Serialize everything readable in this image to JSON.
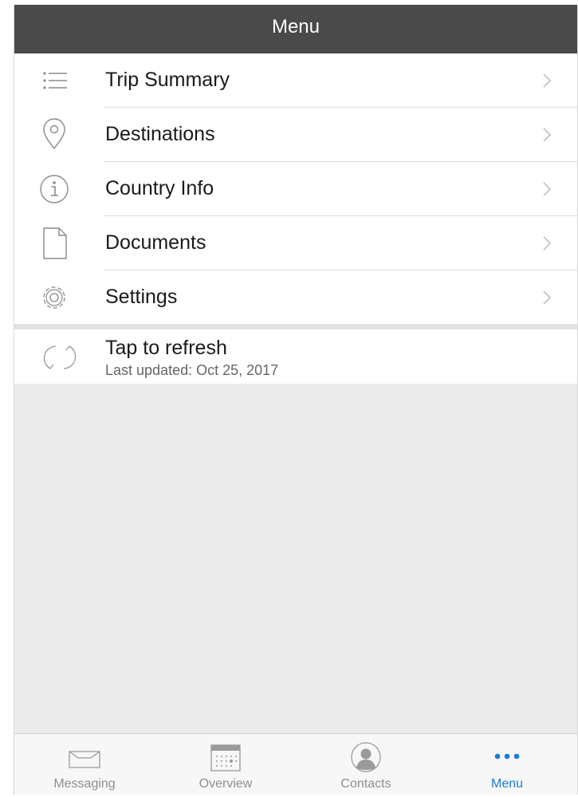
{
  "header": {
    "title": "Menu"
  },
  "menu": {
    "items": [
      {
        "label": "Trip Summary",
        "icon": "list-icon"
      },
      {
        "label": "Destinations",
        "icon": "location-pin-icon"
      },
      {
        "label": "Country Info",
        "icon": "info-icon"
      },
      {
        "label": "Documents",
        "icon": "document-icon"
      },
      {
        "label": "Settings",
        "icon": "gear-icon"
      }
    ]
  },
  "refresh": {
    "label": "Tap to refresh",
    "last_updated": "Last updated: Oct 25, 2017",
    "icon": "refresh-icon"
  },
  "tabbar": {
    "active": 3,
    "active_color": "#1b7bd8",
    "tabs": [
      {
        "label": "Messaging",
        "icon": "inbox-icon"
      },
      {
        "label": "Overview",
        "icon": "calendar-icon"
      },
      {
        "label": "Contacts",
        "icon": "contact-icon"
      },
      {
        "label": "Menu",
        "icon": "more-dots-icon"
      }
    ]
  }
}
